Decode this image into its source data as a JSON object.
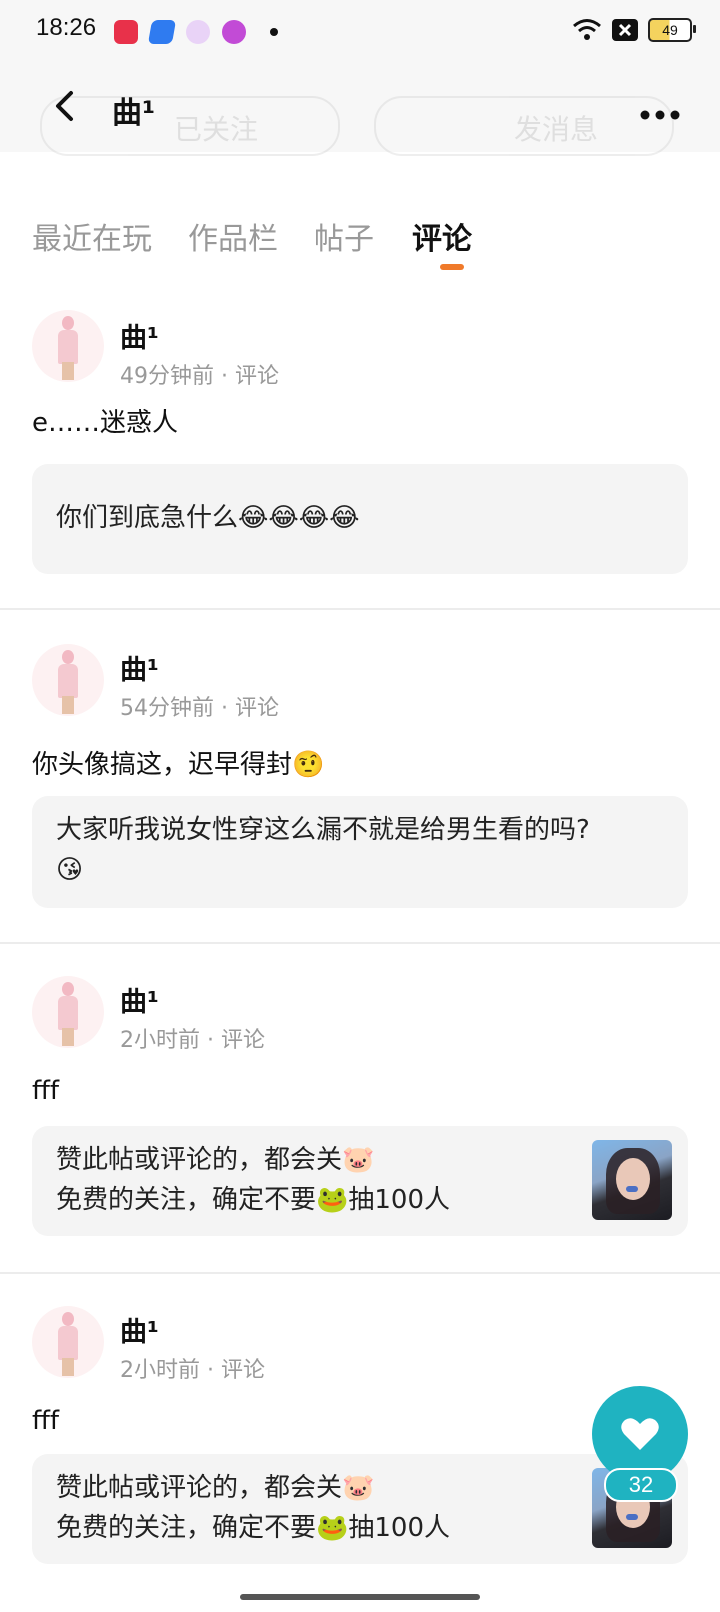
{
  "status_bar": {
    "time": "18:26",
    "battery": "49",
    "icons": [
      "video-app-icon",
      "blue-app-icon",
      "heart-app-icon",
      "paint-app-icon",
      "wifi-icon",
      "close-box-icon",
      "battery-icon"
    ]
  },
  "header": {
    "title": "曲¹",
    "ghost_follow": "已关注",
    "ghost_message": "发消息"
  },
  "tabs": [
    {
      "label": "最近在玩"
    },
    {
      "label": "作品栏"
    },
    {
      "label": "帖子"
    },
    {
      "label": "评论",
      "active": true
    }
  ],
  "comments": [
    {
      "username": "曲¹",
      "meta": "49分钟前 · 评论",
      "text": "e……迷惑人",
      "quote_lines": [
        "你们到底急什么😂😂😂😂"
      ]
    },
    {
      "username": "曲¹",
      "meta": "54分钟前 · 评论",
      "text": "你头像搞这，迟早得封🤨",
      "quote_lines": [
        "大家听我说女性穿这么漏不就是给男生看的吗?",
        "😘"
      ]
    },
    {
      "username": "曲¹",
      "meta": "2小时前 · 评论",
      "text": "fff",
      "quote_lines": [
        "赞此帖或评论的，都会关🐷",
        "免费的关注，确定不要🐸抽100人"
      ],
      "has_thumbnail": true
    },
    {
      "username": "曲¹",
      "meta": "2小时前 · 评论",
      "text": "fff",
      "quote_lines": [
        "赞此帖或评论的，都会关🐷",
        "免费的关注，确定不要🐸抽100人"
      ],
      "has_thumbnail": true
    }
  ],
  "like_fab": {
    "count": "32",
    "icon": "heart-icon"
  },
  "colors": {
    "accent": "#f07a2a",
    "fab": "#1fb3c1"
  }
}
